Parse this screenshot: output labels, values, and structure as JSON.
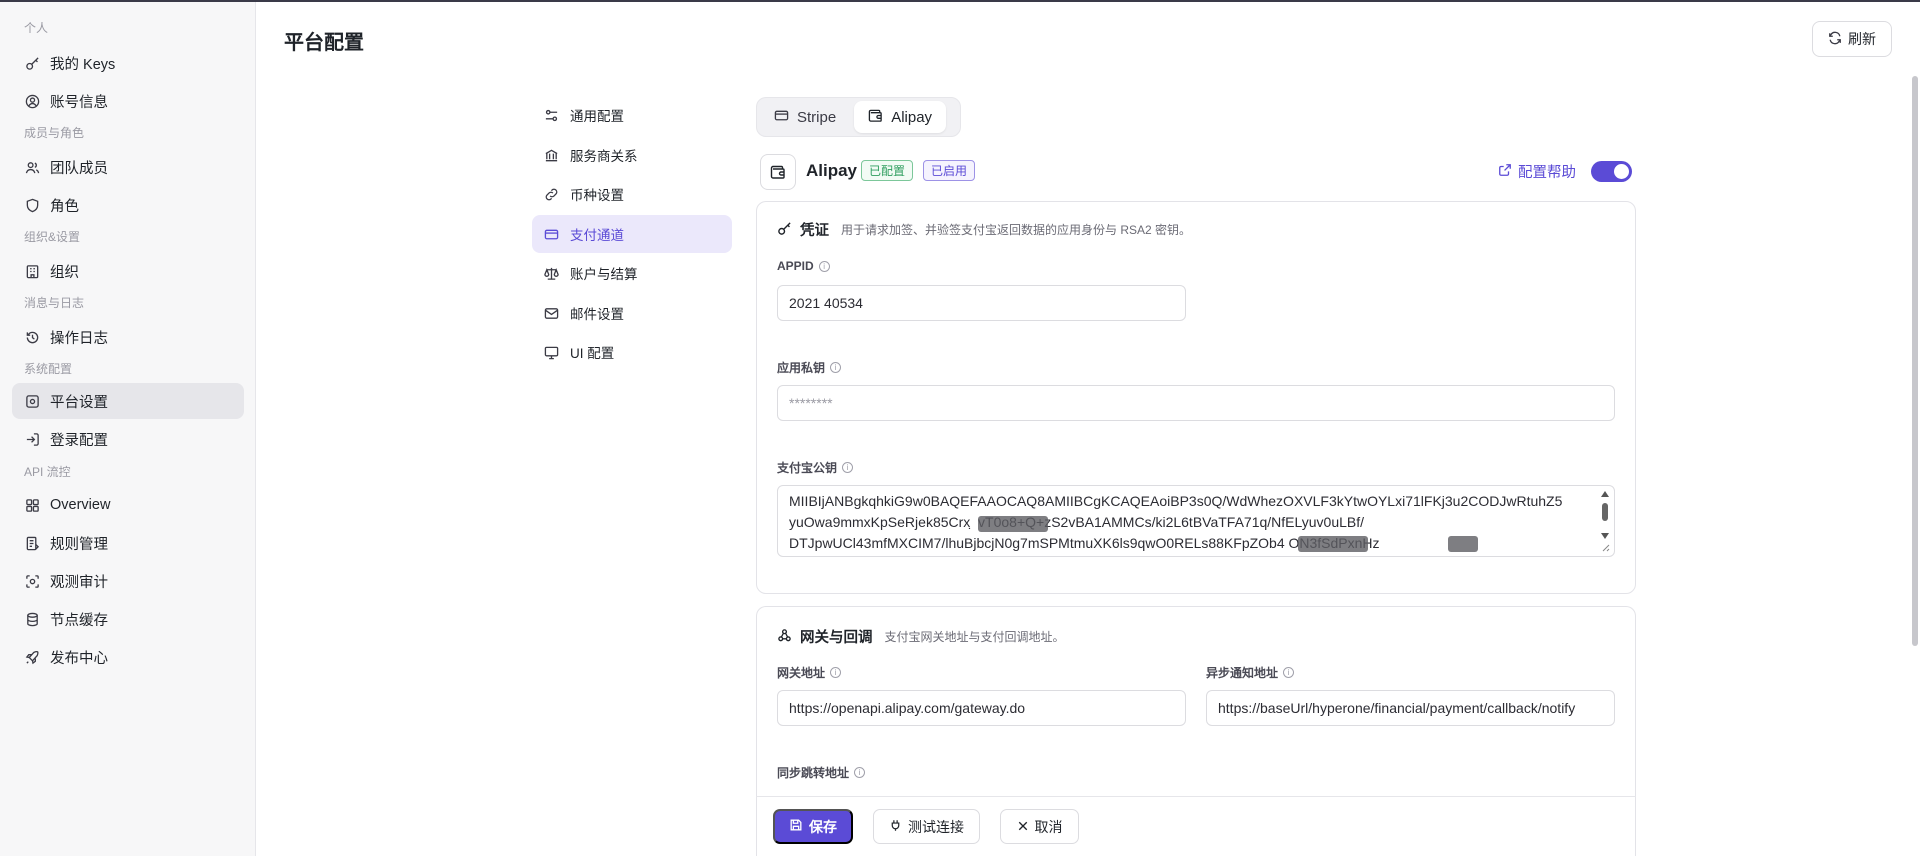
{
  "sidebar": {
    "groups": [
      "个人",
      "成员与角色",
      "组织&设置",
      "消息与日志",
      "系统配置",
      "API 流控"
    ],
    "items": [
      {
        "label": "我的 Keys"
      },
      {
        "label": "账号信息"
      },
      {
        "label": "团队成员"
      },
      {
        "label": "角色"
      },
      {
        "label": "组织"
      },
      {
        "label": "操作日志"
      },
      {
        "label": "平台设置"
      },
      {
        "label": "登录配置"
      },
      {
        "label": "Overview"
      },
      {
        "label": "规则管理"
      },
      {
        "label": "观测审计"
      },
      {
        "label": "节点缓存"
      },
      {
        "label": "发布中心"
      }
    ]
  },
  "header": {
    "title": "平台配置",
    "refresh_label": "刷新"
  },
  "settings_nav": [
    {
      "label": "通用配置"
    },
    {
      "label": "服务商关系"
    },
    {
      "label": "币种设置"
    },
    {
      "label": "支付通道"
    },
    {
      "label": "账户与结算"
    },
    {
      "label": "邮件设置"
    },
    {
      "label": "UI 配置"
    }
  ],
  "tabs": [
    {
      "label": "Stripe"
    },
    {
      "label": "Alipay"
    }
  ],
  "provider": {
    "name": "Alipay",
    "badge_configured": "已配置",
    "badge_enabled": "已启用",
    "help_label": "配置帮助",
    "enabled": true
  },
  "credentials": {
    "title": "凭证",
    "description": "用于请求加签、并验签支付宝返回数据的应用身份与 RSA2 密钥。",
    "appid_label": "APPID",
    "appid_value": "2021            40534",
    "private_key_label": "应用私钥",
    "private_key_placeholder": "********",
    "public_key_label": "支付宝公钥",
    "public_key_lines": [
      "MIIBIjANBgkqhkiG9w0BAQEFAAOCAQ8AMIIBCgKCAQEAoiBP3s0Q/WdWhezOXVLF3kYtwOYLxi71lFKj3u2CODJwRtuhZ5",
      "yuOwa9mmxKpSeRjek85Crx                          ̣ vT0o8+Q+zS2vBA1AMMCs/ki2L6tBVaTFA71q/NfELyuv0uLBf/",
      "DTJpwUCl43mfMXCIM7/lhuBjbcjN0g7mSPMtmuXK6ls9qwO0RELs88KFpZOb4                               ON3fSdPxnHz"
    ]
  },
  "gateway": {
    "title": "网关与回调",
    "description": "支付宝网关地址与支付回调地址。",
    "gateway_label": "网关地址",
    "gateway_value": "https://openapi.alipay.com/gateway.do",
    "notify_label": "异步通知地址",
    "notify_value": "https://baseUrl/hyperone/financial/payment/callback/notify",
    "return_label": "同步跳转地址"
  },
  "actions": {
    "save": "保存",
    "test": "测试连接",
    "cancel": "取消"
  },
  "colors": {
    "accent": "#5b4bd6",
    "success": "#2f9e5f"
  }
}
